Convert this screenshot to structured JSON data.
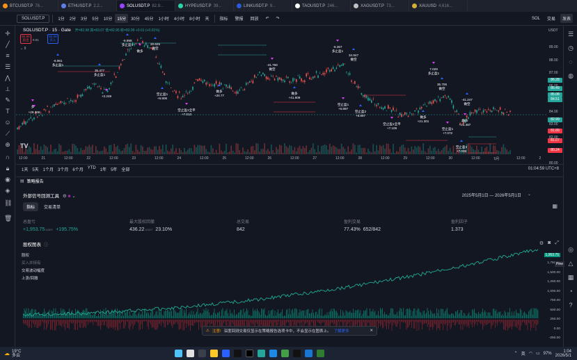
{
  "tabs": [
    {
      "label": "BTCUSDT.P",
      "price": "76...",
      "color": "#f7931a"
    },
    {
      "label": "ETHUSDT.P",
      "price": "2.2...",
      "color": "#627eea"
    },
    {
      "label": "SOLUSDT.P",
      "price": "82.9...",
      "color": "#9945ff"
    },
    {
      "label": "HYPEUSDT.P",
      "price": "39...",
      "color": "#2bd4a4"
    },
    {
      "label": "LINKUSDT.P",
      "price": "9...",
      "color": "#2a5ada"
    },
    {
      "label": "TAOUSDT.P",
      "price": "246...",
      "color": "#ffffff"
    },
    {
      "label": "XAGUSDT.P",
      "price": "73...",
      "color": "#c0c0c0"
    },
    {
      "label": "XAUUSD",
      "price": "4,616...",
      "color": "#d4af37"
    }
  ],
  "toolbar": {
    "symbol": "SOLUSDT.P",
    "timeframes": [
      "1分",
      "2分",
      "3分",
      "5分",
      "10分",
      "15分",
      "30分",
      "45分",
      "1小时",
      "4小时",
      "8小时",
      "天"
    ],
    "active_timeframe": "15分",
    "indicators": "指标",
    "alert": "警报",
    "replay": "回放",
    "sol": "SOL",
    "trade": "交易",
    "publish": "发表"
  },
  "chart": {
    "title": "SOLUSDT.P · 15 · Gate",
    "ohlc": "开=82.98 高=83.07 低=82.95 收=82.99 +0.01 (+0.01%)",
    "sell_price": "82.98",
    "sell_label": "卖出",
    "spread": "0.01",
    "buy_price": "82.99",
    "buy_label": "买入",
    "indicator_count": "9",
    "currency": "USDT",
    "price_ticks": [
      "89.00",
      "88.00",
      "87.00",
      "86.00",
      "85.00",
      "84.00",
      "83.00",
      "82.00",
      "81.00",
      "80.00"
    ],
    "price_labels": [
      {
        "text": "86.28",
        "color": "#26a69a"
      },
      {
        "text": "85.49",
        "color": "#26a69a"
      },
      {
        "text": "85.08",
        "color": "#26a69a"
      },
      {
        "text": "84.51",
        "color": "#26a69a"
      },
      {
        "text": "82.99",
        "color": "#26a69a"
      },
      {
        "text": "81.89",
        "color": "#f23645"
      },
      {
        "text": "81.07",
        "color": "#f23645"
      },
      {
        "text": "80.24",
        "color": "#f23645"
      }
    ],
    "countdown": "12:00",
    "time_ticks": [
      "12:00",
      "21",
      "12:00",
      "22",
      "12:00",
      "23",
      "12:00",
      "24",
      "12:00",
      "25",
      "12:00",
      "26",
      "12:00",
      "27",
      "12:00",
      "28",
      "12:00",
      "29",
      "12:00",
      "30",
      "12:00",
      "5月",
      "12:00",
      "2"
    ],
    "annotations": [
      {
        "text": "-6.961\n多止盈1",
        "color": "#ffffff"
      },
      {
        "text": "多",
        "color": "#ffffff"
      },
      {
        "text": "35.477\n多止盈1",
        "color": "#ffffff"
      },
      {
        "text": "+2.249",
        "color": "#ffffff"
      },
      {
        "text": "-6.898\n多止盈1",
        "color": "#ffffff"
      },
      {
        "text": "做多",
        "color": "#ffffff"
      },
      {
        "text": "20.625\n做空",
        "color": "#ffffff"
      },
      {
        "text": "+28.268",
        "color": "#ffffff"
      },
      {
        "text": "空止盈1\n+6.806",
        "color": "#ffffff"
      },
      {
        "text": "空止盈1全平\n+7.013",
        "color": "#ffffff"
      },
      {
        "text": "做多\n+20.77",
        "color": "#ffffff"
      },
      {
        "text": "-41.768\n做空",
        "color": "#ffffff"
      },
      {
        "text": "做多\n+41.809",
        "color": "#ffffff"
      },
      {
        "text": "-6.367\n多止盈1",
        "color": "#ffffff"
      },
      {
        "text": "34.847\n做空",
        "color": "#ffffff"
      },
      {
        "text": "空止盈1\n+6.897",
        "color": "#ffffff"
      },
      {
        "text": "空止盈2\n+6.897",
        "color": "#ffffff"
      },
      {
        "text": "空止盈1全平\n+7.109",
        "color": "#ffffff"
      },
      {
        "text": "做多\n+21.301",
        "color": "#ffffff"
      },
      {
        "text": "7.029\n多止盈1",
        "color": "#ffffff"
      },
      {
        "text": "35.705\n做空",
        "color": "#ffffff"
      },
      {
        "text": "空止盈1\n+7.072",
        "color": "#ffffff"
      },
      {
        "text": "-41.247\n做空",
        "color": "#ffffff"
      },
      {
        "text": "做多\n+21.487",
        "color": "#ffffff"
      },
      {
        "text": "空止盈2\n+7.033",
        "color": "#ffffff"
      }
    ],
    "logo": "TV"
  },
  "range": {
    "buttons": [
      "1天",
      "5天",
      "1个月",
      "3个月",
      "6个月",
      "YTD",
      "1年",
      "5年",
      "全部"
    ],
    "clock": "01:04:59 UTC+8"
  },
  "panel": {
    "title": "策略报告"
  },
  "strategy": {
    "name": "外部信号回测工具",
    "tab_indicators": "指标",
    "tab_trades": "交易清单",
    "date_range": "2025年5月1日 — 2026年5月1日",
    "metrics": [
      {
        "label": "总盈亏",
        "value": "+1,953.75",
        "unit": "USDT",
        "extra": "+195.75%",
        "color": "#26a69a"
      },
      {
        "label": "最大股权回撤",
        "value": "436.22",
        "unit": "USDT",
        "extra": "23.10%",
        "color": "#d1d4dc"
      },
      {
        "label": "总交易",
        "value": "842",
        "unit": "",
        "extra": "",
        "color": "#d1d4dc"
      },
      {
        "label": "盈利交易",
        "value": "77.43%",
        "unit": "",
        "extra": "652/842",
        "color": "#d1d4dc"
      },
      {
        "label": "盈利因子",
        "value": "1.373",
        "unit": "",
        "extra": "",
        "color": "#d1d4dc"
      }
    ],
    "equity_title": "股权图表",
    "legend": [
      "股权",
      "买入并持有",
      "交易波动幅度",
      "上涨/回撤"
    ],
    "axis_labels": [
      "1,750.00",
      "1,500.00",
      "1,250.00",
      "1,000.00",
      "750.00",
      "500.00",
      "250.00",
      "0.00",
      "-250.00"
    ],
    "last_value": "1,953.75",
    "pine": "Pine"
  },
  "toast": {
    "label": "注意!",
    "text": "深度回测交易仅显示在策略报告选项卡中，不会显示在图表上。",
    "link": "了解更多"
  },
  "taskbar": {
    "weather_temp": "19°C",
    "weather_desc": "多云",
    "lang": "英",
    "battery": "97%",
    "time": "1:04",
    "date": "2026/5/1"
  }
}
